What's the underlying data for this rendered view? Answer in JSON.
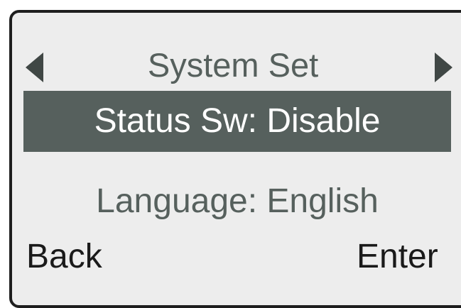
{
  "screen": {
    "title": "System Set",
    "nav": {
      "prev_icon": "triangle-left-icon",
      "next_icon": "triangle-right-icon"
    },
    "menu": {
      "items": [
        {
          "label": "Status Sw: Disable",
          "selected": true
        },
        {
          "label": "Language: English",
          "selected": false
        }
      ]
    },
    "softkeys": {
      "back_label": "Back",
      "enter_label": "Enter"
    }
  },
  "colors": {
    "screen_background": "#ededed",
    "bezel": "#1e1e1e",
    "highlight": "#56605d",
    "highlight_text": "#ffffff",
    "dim_text": "#56605d",
    "softkey_text": "#1a1a1a",
    "arrow": "#404745"
  }
}
